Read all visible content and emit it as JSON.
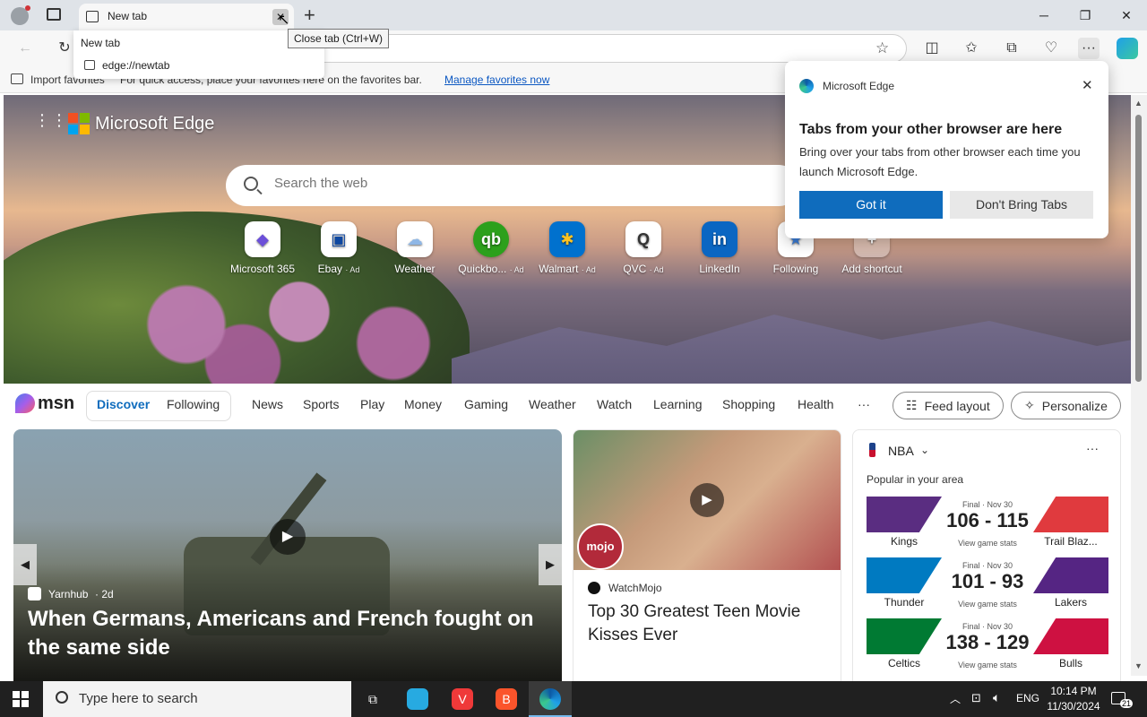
{
  "browser": {
    "tab_title": "New tab",
    "tab_close_tooltip": "Close tab (Ctrl+W)",
    "tab_hover": {
      "title": "New tab",
      "url": "edge://newtab"
    },
    "new_tab_symbol": "+",
    "window": {
      "minimize": "─",
      "restore": "❐",
      "close": "✕"
    }
  },
  "favorites_bar": {
    "import_label": "Import favorites",
    "hint": "For quick access, place your favorites here on the favorites bar.",
    "manage_link": "Manage favorites now"
  },
  "newtab": {
    "brand": "Microsoft Edge",
    "search_placeholder": "Search the web",
    "quick_links": [
      {
        "label": "Microsoft 365",
        "ad": "",
        "color": "#6b4fd8"
      },
      {
        "label": "Ebay",
        "ad": "· Ad",
        "color": "#0d47a1"
      },
      {
        "label": "Weather",
        "ad": "",
        "color": "#8fb7e6"
      },
      {
        "label": "Quickbo...",
        "ad": "· Ad",
        "color": "#2ca01c"
      },
      {
        "label": "Walmart",
        "ad": "· Ad",
        "color": "#0071ce"
      },
      {
        "label": "QVC",
        "ad": "· Ad",
        "color": "#333333"
      },
      {
        "label": "LinkedIn",
        "ad": "",
        "color": "#0a66c2"
      },
      {
        "label": "Following",
        "ad": "",
        "color": "#3a7bd5"
      },
      {
        "label": "Add shortcut",
        "ad": "",
        "color": "#666666"
      }
    ]
  },
  "popup": {
    "app_name": "Microsoft Edge",
    "title": "Tabs from your other browser are here",
    "body": "Bring over your tabs from other browser each time you launch Microsoft Edge.",
    "primary": "Got it",
    "secondary": "Don't Bring Tabs"
  },
  "msn": {
    "logo": "msn",
    "nav": [
      "Discover",
      "Following",
      "News",
      "Sports",
      "Play",
      "Money",
      "Gaming",
      "Weather",
      "Watch",
      "Learning",
      "Shopping",
      "Health",
      "···"
    ],
    "feed_layout": "Feed layout",
    "personalize": "Personalize"
  },
  "card1": {
    "source": "Yarnhub",
    "age": "· 2d",
    "title": "When Germans, Americans and French fought on the same side"
  },
  "card2": {
    "badge": "mojo",
    "source": "WatchMojo",
    "title": "Top 30 Greatest Teen Movie Kisses Ever"
  },
  "nba": {
    "league": "NBA",
    "subtitle": "Popular in your area",
    "games": [
      {
        "status": "Final · Nov 30",
        "score": "106 - 115",
        "stats": "View game stats",
        "home": "Kings",
        "away": "Trail Blaz...",
        "color_l": "#5a2d81",
        "color_r": "#e03a3e"
      },
      {
        "status": "Final · Nov 30",
        "score": "101 - 93",
        "stats": "View game stats",
        "home": "Thunder",
        "away": "Lakers",
        "color_l": "#007ac1",
        "color_r": "#552583"
      },
      {
        "status": "Final · Nov 30",
        "score": "138 - 129",
        "stats": "View game stats",
        "home": "Celtics",
        "away": "Bulls",
        "color_l": "#007a33",
        "color_r": "#ce1141"
      }
    ]
  },
  "taskbar": {
    "search": "Type here to search",
    "lang": "ENG",
    "time": "10:14 PM",
    "date": "11/30/2024",
    "notifications": "21"
  }
}
